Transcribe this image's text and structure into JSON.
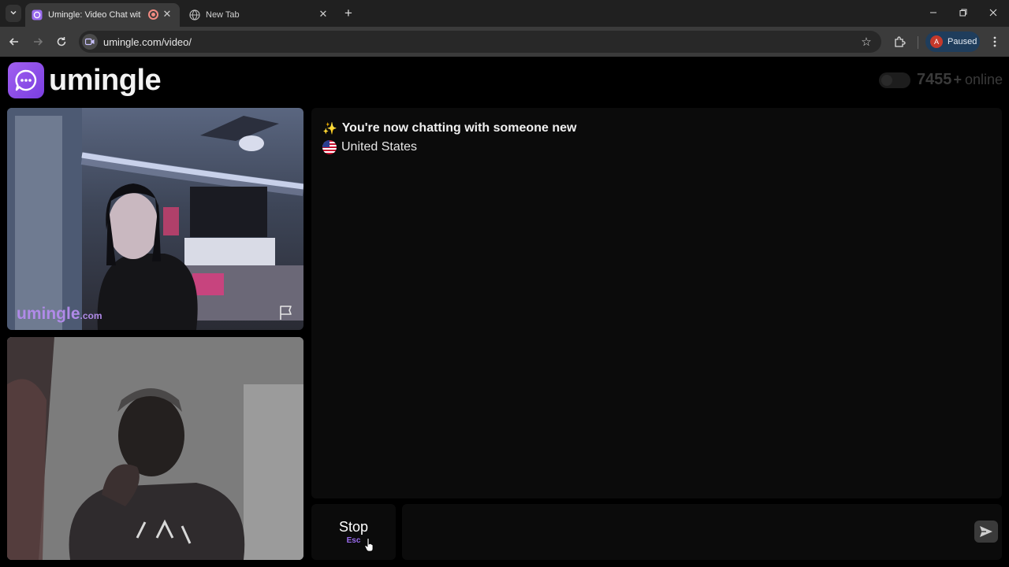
{
  "browser": {
    "tabs": [
      {
        "title": "Umingle: Video Chat with St",
        "active": true,
        "icon": "umingle-chat-icon",
        "recording": true
      },
      {
        "title": "New Tab",
        "active": false,
        "icon": "globe-icon"
      }
    ],
    "url": "umingle.com/video/",
    "profile": {
      "initial": "A",
      "label": "Paused"
    }
  },
  "header": {
    "logo_text": "umingle",
    "online_count": "7455",
    "online_plus": "+",
    "online_label": "online"
  },
  "videos": {
    "stranger_watermark": "umingle",
    "stranger_watermark_suffix": ".com"
  },
  "chat": {
    "system_message": "You're now chatting with someone new",
    "country": "United States",
    "input_value": "",
    "input_placeholder": ""
  },
  "controls": {
    "stop_label": "Stop",
    "stop_key": "Esc"
  },
  "colors": {
    "brand": "#9b6cf0",
    "background": "#000000",
    "panel": "#0b0b0b"
  }
}
